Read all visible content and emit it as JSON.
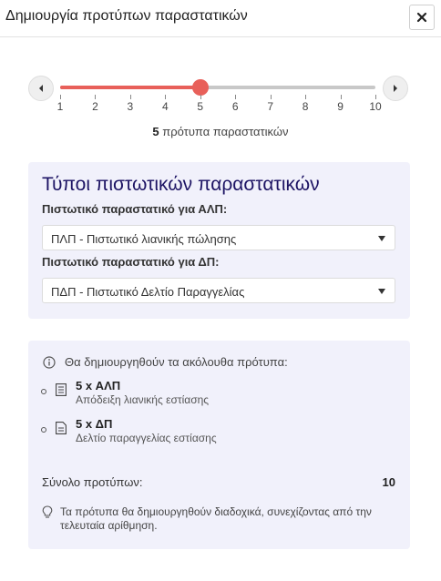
{
  "dialog": {
    "title": "Δημιουργία προτύπων παραστατικών"
  },
  "slider": {
    "min": 1,
    "max": 10,
    "value": 5,
    "ticks": [
      "1",
      "2",
      "3",
      "4",
      "5",
      "6",
      "7",
      "8",
      "9",
      "10"
    ],
    "count_value": "5",
    "count_suffix": " πρότυπα παραστατικών",
    "accent_color": "#e8605a"
  },
  "types": {
    "heading": "Τύποι πιστωτικών παραστατικών",
    "alp_label": "Πιστωτικό παραστατικό για ΑΛΠ:",
    "alp_selected": "ΠΛΠ - Πιστωτικό λιανικής πώλησης",
    "dp_label": "Πιστωτικό παραστατικό για ΔΠ:",
    "dp_selected": "ΠΔΠ - Πιστωτικό Δελτίο Παραγγελίας"
  },
  "summary": {
    "info": "Θα δημιουργηθούν τα ακόλουθα πρότυπα:",
    "items": [
      {
        "title": "5 x ΑΛΠ",
        "subtitle": "Απόδειξη λιανικής εστίασης",
        "icon": "receipt-icon"
      },
      {
        "title": "5 x ΔΠ",
        "subtitle": "Δελτίο παραγγελίας εστίασης",
        "icon": "document-icon"
      }
    ],
    "total_label": "Σύνολο προτύπων:",
    "total_value": "10",
    "hint": "Τα πρότυπα θα δημιουργηθούν διαδοχικά, συνεχίζοντας από την τελευταία αρίθμηση."
  }
}
